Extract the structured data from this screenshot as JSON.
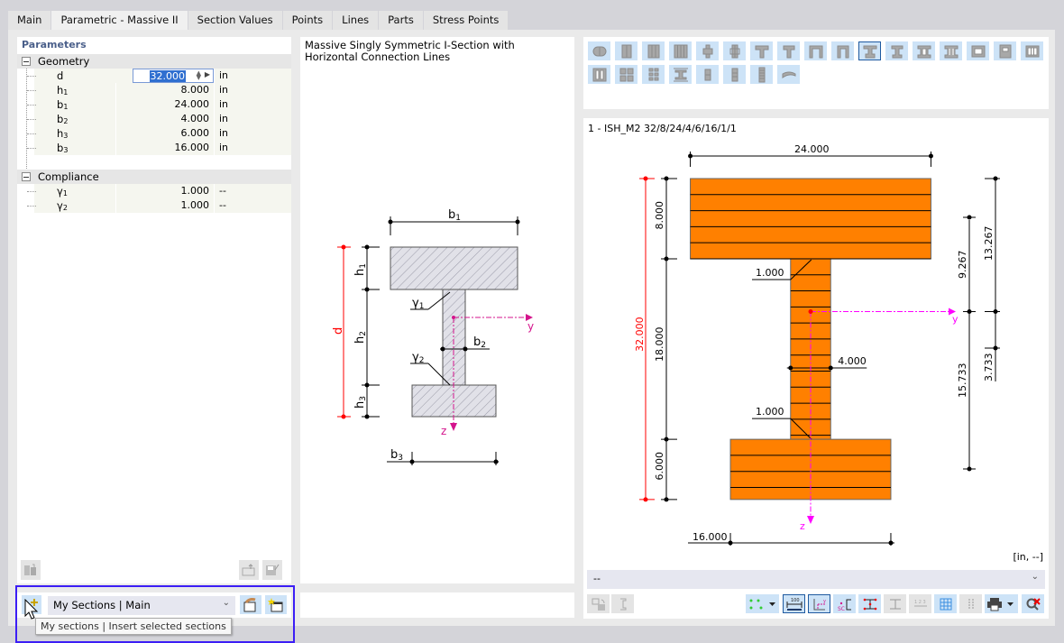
{
  "tabs": [
    {
      "label": "Main",
      "active": false
    },
    {
      "label": "Parametric - Massive II",
      "active": true
    },
    {
      "label": "Section Values",
      "active": false
    },
    {
      "label": "Points",
      "active": false
    },
    {
      "label": "Lines",
      "active": false
    },
    {
      "label": "Parts",
      "active": false
    },
    {
      "label": "Stress Points",
      "active": false
    }
  ],
  "parameters": {
    "title": "Parameters",
    "geometry": {
      "label": "Geometry",
      "rows": [
        {
          "name": "d",
          "sub": "",
          "value": "32.000",
          "unit": "in",
          "editing": true
        },
        {
          "name": "h",
          "sub": "1",
          "value": "8.000",
          "unit": "in"
        },
        {
          "name": "b",
          "sub": "1",
          "value": "24.000",
          "unit": "in"
        },
        {
          "name": "b",
          "sub": "2",
          "value": "4.000",
          "unit": "in"
        },
        {
          "name": "h",
          "sub": "3",
          "value": "6.000",
          "unit": "in"
        },
        {
          "name": "b",
          "sub": "3",
          "value": "16.000",
          "unit": "in"
        }
      ]
    },
    "compliance": {
      "label": "Compliance",
      "rows": [
        {
          "name": "γ",
          "sub": "1",
          "value": "1.000",
          "unit": "--"
        },
        {
          "name": "γ",
          "sub": "2",
          "value": "1.000",
          "unit": "--"
        }
      ]
    }
  },
  "schematic": {
    "title": "Massive Singly Symmetric I-Section with Horizontal Connection Lines",
    "labels": {
      "b1": "b",
      "b1_sub": "1",
      "b2": "b",
      "b2_sub": "2",
      "b3": "b",
      "b3_sub": "3",
      "h1": "h",
      "h1_sub": "1",
      "h2": "h",
      "h2_sub": "2",
      "h3": "h",
      "h3_sub": "3",
      "d": "d",
      "g1": "γ",
      "g1_sub": "1",
      "g2": "γ",
      "g2_sub": "2",
      "y": "y",
      "z": "z"
    }
  },
  "section_types": {
    "icons": [
      "round-massive",
      "two-plates",
      "three-plates",
      "four-plates",
      "cross-plates",
      "double-cross",
      "t-section",
      "t-section-2",
      "pi-section",
      "pi-section-2",
      "i-singly-symmetric",
      "i-section-2",
      "i-section-3",
      "i-section-4",
      "box-horizontal",
      "box-vertical",
      "box-multi",
      "box-multi-2",
      "grid-four",
      "grid-six",
      "i-with-lines",
      "rect-two",
      "rect-three",
      "rect-five",
      "curved-section"
    ],
    "selected_index": 10
  },
  "section_view": {
    "title": "1 - ISH_M2 32/8/24/4/6/16/1/1",
    "units": "[in, --]",
    "dims": {
      "top_width": "24.000",
      "bottom_width": "16.000",
      "web_width": "4.000",
      "total_height": "32.000",
      "h1": "8.000",
      "h2": "18.000",
      "h3": "6.000",
      "g1": "1.000",
      "g2": "1.000",
      "right_top": "9.267",
      "right_bottom": "15.733",
      "far_top": "13.267",
      "far_bottom": "3.733",
      "y": "y",
      "z": "z"
    },
    "model": {
      "d": 32,
      "h1": 8,
      "b1": 24,
      "b2": 4,
      "h3": 6,
      "b3": 16,
      "centroid_from_top": 13.267
    },
    "colors": {
      "fill": "#ff8000",
      "dim_red": "#ff0000",
      "axis": "#ff00ff"
    },
    "dropdown_value": "--"
  },
  "bottom_left": {
    "combo_value": "My Sections | Main",
    "tooltip": "My sections | Insert selected sections"
  }
}
